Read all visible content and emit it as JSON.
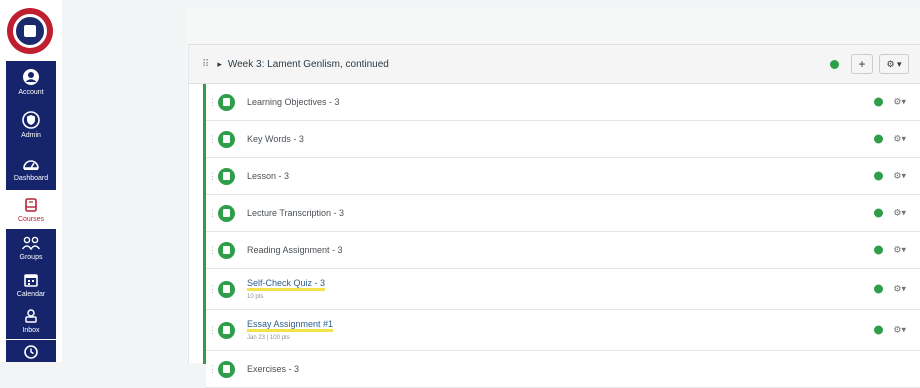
{
  "nav": {
    "items": [
      {
        "key": "account",
        "label": "Account",
        "icon": "user-icon"
      },
      {
        "key": "admin",
        "label": "Admin",
        "icon": "shield-icon"
      },
      {
        "key": "dashboard",
        "label": "Dashboard",
        "icon": "dashboard-icon"
      },
      {
        "key": "courses",
        "label": "Courses",
        "icon": "book-icon",
        "active": true
      },
      {
        "key": "groups",
        "label": "Groups",
        "icon": "groups-icon"
      },
      {
        "key": "calendar",
        "label": "Calendar",
        "icon": "calendar-icon"
      },
      {
        "key": "inbox",
        "label": "Inbox",
        "icon": "inbox-icon"
      },
      {
        "key": "history",
        "label": "",
        "icon": "clock-icon"
      }
    ]
  },
  "module": {
    "title": "Week 3: Lament Genlism, continued",
    "add_label": "+",
    "settings_label": "⚙ ▾",
    "items": [
      {
        "title": "Learning Objectives - 3",
        "meta": ""
      },
      {
        "title": "Key Words - 3",
        "meta": ""
      },
      {
        "title": "Lesson - 3",
        "meta": ""
      },
      {
        "title": "Lecture Transcription - 3",
        "meta": ""
      },
      {
        "title": "Reading Assignment - 3",
        "meta": ""
      },
      {
        "title": "Self-Check Quiz - 3",
        "meta": "10 pts"
      },
      {
        "title": "Essay Assignment #1",
        "meta": "Jan 23 | 100 pts"
      },
      {
        "title": "Exercises - 3",
        "meta": ""
      }
    ]
  },
  "colors": {
    "nav_bg": "#15246b",
    "published_green": "#2e9e4a",
    "highlight": "#f3e34a",
    "active_red": "#b52438"
  }
}
